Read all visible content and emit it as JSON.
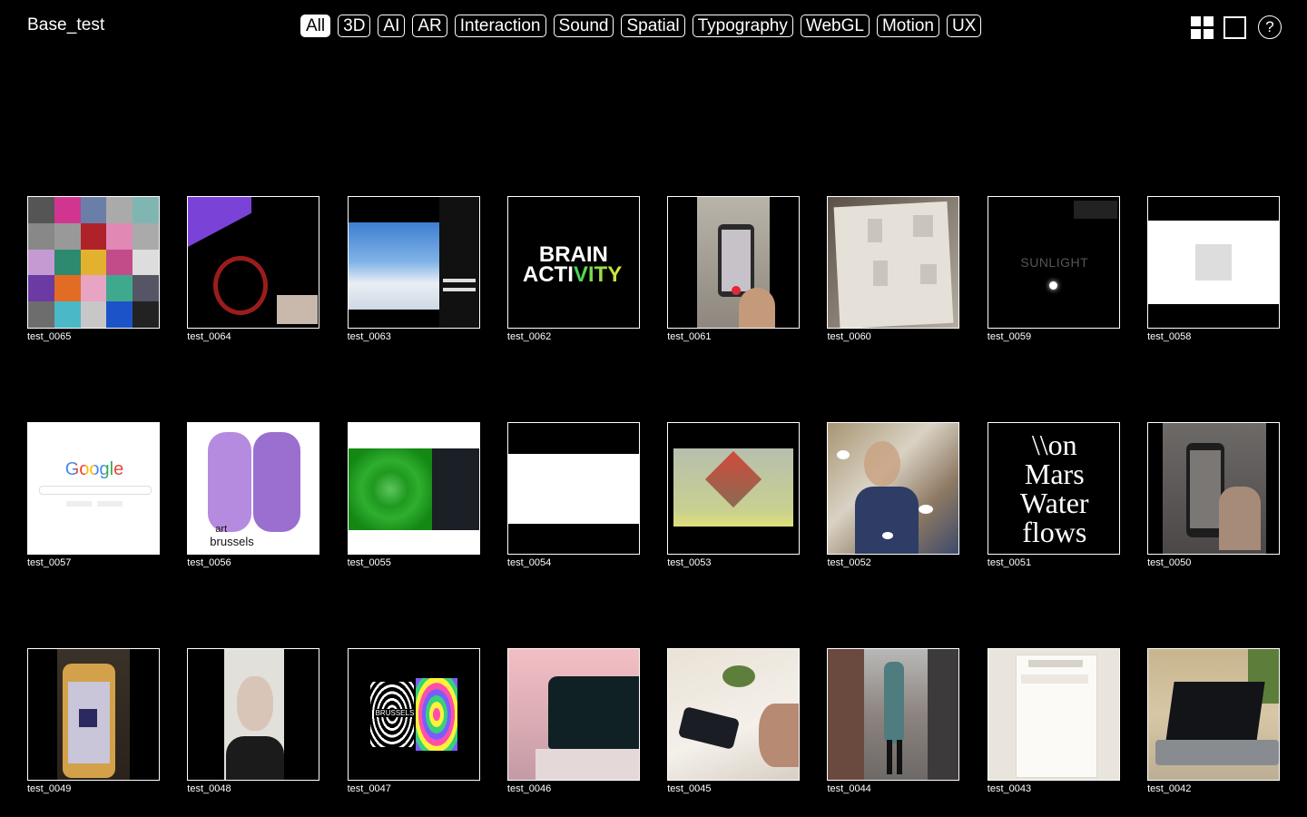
{
  "header": {
    "brand": "Base_test",
    "filters": [
      "All",
      "3D",
      "AI",
      "AR",
      "Interaction",
      "Sound",
      "Spatial",
      "Typography",
      "WebGL",
      "Motion",
      "UX"
    ],
    "active_filter": "All",
    "help_label": "?"
  },
  "thumb_text": {
    "brain_line1": "BRAIN",
    "brain_line2": "ACTIVITY",
    "sunlight": "SUNLIGHT",
    "google": "Google",
    "art": "art",
    "brussels": "brussels",
    "mars_1": "\\\\on",
    "mars_2": "Mars",
    "mars_3": "Water",
    "mars_4": "flows",
    "glitch": "BRUSSELS"
  },
  "items": [
    {
      "title": "test_0065"
    },
    {
      "title": "test_0064"
    },
    {
      "title": "test_0063"
    },
    {
      "title": "test_0062"
    },
    {
      "title": "test_0061"
    },
    {
      "title": "test_0060"
    },
    {
      "title": "test_0059"
    },
    {
      "title": "test_0058"
    },
    {
      "title": "test_0057"
    },
    {
      "title": "test_0056"
    },
    {
      "title": "test_0055"
    },
    {
      "title": "test_0054"
    },
    {
      "title": "test_0053"
    },
    {
      "title": "test_0052"
    },
    {
      "title": "test_0051"
    },
    {
      "title": "test_0050"
    },
    {
      "title": "test_0049"
    },
    {
      "title": "test_0048"
    },
    {
      "title": "test_0047"
    },
    {
      "title": "test_0046"
    },
    {
      "title": "test_0045"
    },
    {
      "title": "test_0044"
    },
    {
      "title": "test_0043"
    },
    {
      "title": "test_0042"
    }
  ]
}
